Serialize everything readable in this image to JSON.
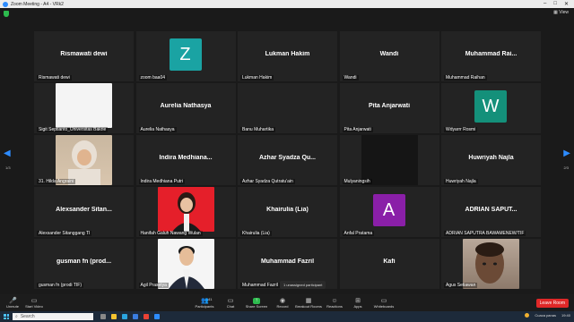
{
  "window": {
    "title": "Zoom Meeting - A4 - VRk2",
    "view_label": "View"
  },
  "nav": {
    "left_page": "1/3",
    "right_page": "2/3"
  },
  "participants": [
    {
      "big_name": "Rismawati dewi",
      "label": "Rismawati dewi",
      "kind": "name"
    },
    {
      "big_name": "",
      "label": "zoom baa04",
      "kind": "avatar",
      "initial": "Z",
      "color": "#1aa3a3"
    },
    {
      "big_name": "Lukman Hakim",
      "label": "Lukman Hakim",
      "kind": "name"
    },
    {
      "big_name": "Wandi",
      "label": "Wandi",
      "kind": "name"
    },
    {
      "big_name": "Muhammad  Rai...",
      "label": "Muhammad Raihan",
      "kind": "name"
    },
    {
      "big_name": "",
      "label": "Sigit Septianto_Universitas Bakrie",
      "kind": "photo-white"
    },
    {
      "big_name": "Aurelia Nathasya",
      "label": "Aurelia Nathasya",
      "kind": "name"
    },
    {
      "big_name": "",
      "label": "Banu Muhartika",
      "kind": "blank"
    },
    {
      "big_name": "Pita Anjarwati",
      "label": "Pita Anjarwati",
      "kind": "name"
    },
    {
      "big_name": "",
      "label": "Wdyarrr Rosmi",
      "kind": "avatar",
      "initial": "W",
      "color": "#14907a"
    },
    {
      "big_name": "",
      "label": "31. Hilda Angraini",
      "kind": "photo-hijab"
    },
    {
      "big_name": "Indira  Medhiana...",
      "label": "Indira Medhiana Putri",
      "kind": "name"
    },
    {
      "big_name": "Azhar Syadza  Qu...",
      "label": "Azhar Syadza Qutratu'ain",
      "kind": "name"
    },
    {
      "big_name": "",
      "label": "Mulyaningsih",
      "kind": "video-dark"
    },
    {
      "big_name": "Huwriyah Najla",
      "label": "Huwriyah Najla",
      "kind": "name"
    },
    {
      "big_name": "Alexsander  Sitan...",
      "label": "Alexsander Sitanggang TI",
      "kind": "name"
    },
    {
      "big_name": "",
      "label": "Hanifah Galuh Nawang Wulan",
      "kind": "photo-red"
    },
    {
      "big_name": "Khairulia (Lia)",
      "label": "Khairulia (Lia)",
      "kind": "name"
    },
    {
      "big_name": "",
      "label": "Anfal Pratama",
      "kind": "avatar",
      "initial": "A",
      "color": "#8a1fa8"
    },
    {
      "big_name": "ADRIAN  SAPUT...",
      "label": "ADRIAN SAPUTRA BAWAMENEW/TIF",
      "kind": "name"
    },
    {
      "big_name": "gusman fn (prod...",
      "label": "gusman fn (prodi TIF)",
      "kind": "name"
    },
    {
      "big_name": "",
      "label": "Agil Prasetya",
      "kind": "photo-formal"
    },
    {
      "big_name": "Muhammad Fazril",
      "label": "Muhammad Fazril",
      "kind": "name"
    },
    {
      "big_name": "Kafi",
      "label": "",
      "kind": "name"
    },
    {
      "big_name": "",
      "label": "Agus Setiawan",
      "kind": "photo-face"
    }
  ],
  "tooltip": "1 unassigned participant",
  "toolbar": {
    "unmute": "Unmute",
    "start_video": "Start Video",
    "participants": "Participants",
    "participants_count": "41",
    "chat": "Chat",
    "share_screen": "Share Screen",
    "record": "Record",
    "breakout": "Breakout Rooms",
    "reactions": "Reactions",
    "apps": "Apps",
    "whiteboards": "Whiteboards",
    "leave": "Leave Room"
  },
  "taskbar": {
    "search": "Search",
    "weather": "Cuaca panas",
    "time": "19:40"
  }
}
